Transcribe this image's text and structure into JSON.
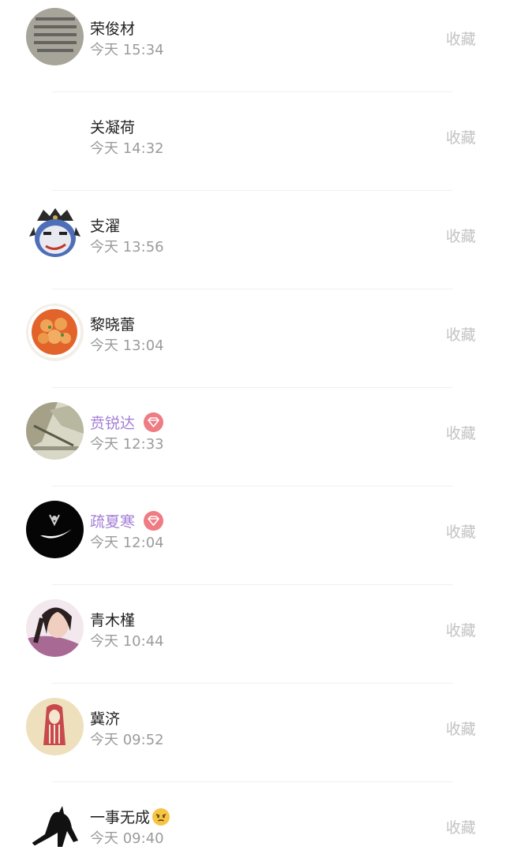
{
  "items": [
    {
      "name": "荣俊材",
      "time": "今天 15:34",
      "action": "收藏",
      "vip": false,
      "avatar": "text-note-avatar"
    },
    {
      "name": "关凝荷",
      "time": "今天 14:32",
      "action": "收藏",
      "vip": false,
      "avatar": "blank-avatar"
    },
    {
      "name": "支濯",
      "time": "今天 13:56",
      "action": "收藏",
      "vip": false,
      "avatar": "opera-face-avatar"
    },
    {
      "name": "黎晓蕾",
      "time": "今天 13:04",
      "action": "收藏",
      "vip": false,
      "avatar": "food-plate-avatar"
    },
    {
      "name": "贲锐达",
      "time": "今天 12:33",
      "action": "收藏",
      "vip": true,
      "avatar": "photo-avatar"
    },
    {
      "name": "疏夏寒",
      "time": "今天 12:04",
      "action": "收藏",
      "vip": true,
      "avatar": "black-logo-avatar"
    },
    {
      "name": "青木槿",
      "time": "今天 10:44",
      "action": "收藏",
      "vip": false,
      "avatar": "portrait-avatar"
    },
    {
      "name": "冀济",
      "time": "今天 09:52",
      "action": "收藏",
      "vip": false,
      "avatar": "red-hair-avatar"
    },
    {
      "name": "一事无成",
      "time": "今天 09:40",
      "action": "收藏",
      "vip": false,
      "avatar": "silhouette-avatar",
      "emoji": "angry-face-icon"
    }
  ],
  "colors": {
    "vip_name": "#a47ed6",
    "vip_badge": "#ef7b83",
    "action": "#c3c3c3",
    "time": "#9b9b9b"
  }
}
